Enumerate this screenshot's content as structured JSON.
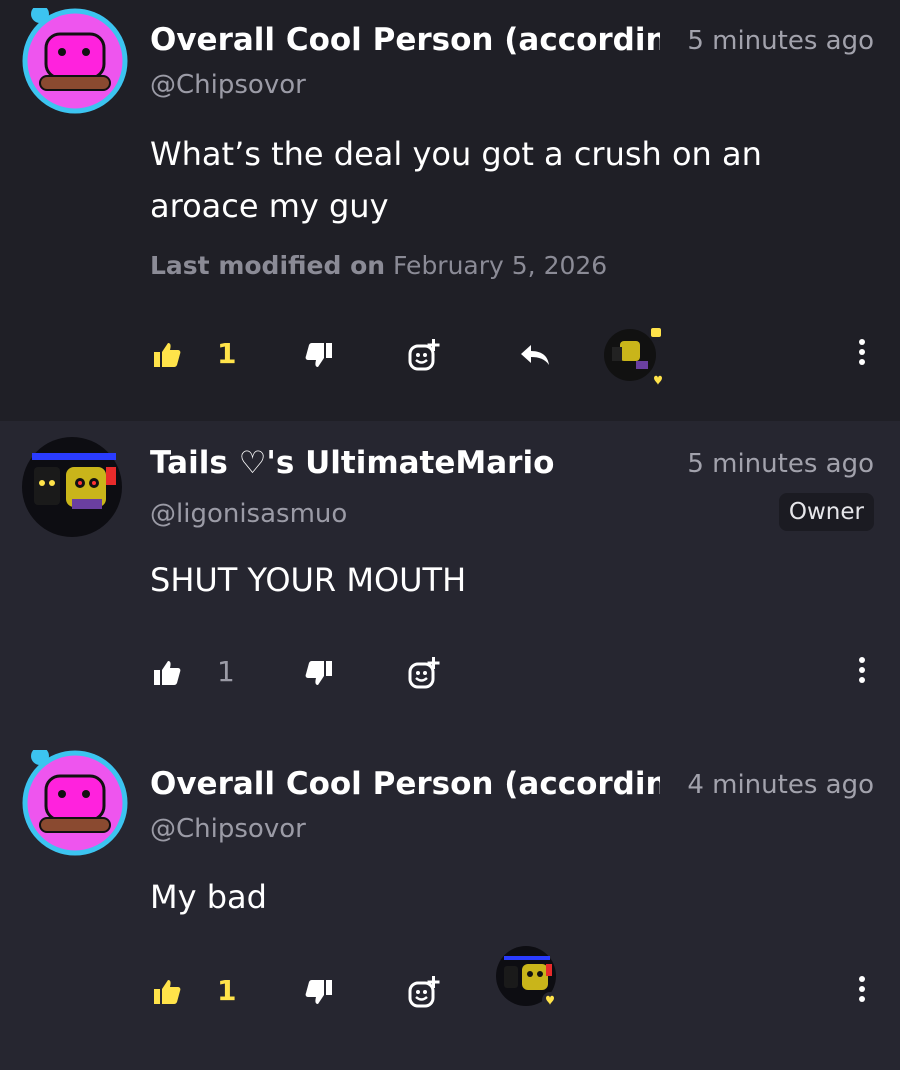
{
  "colors": {
    "accent_yellow": "#ffe34a",
    "bg_dark": "#1f1f26",
    "bg": "#262630",
    "muted": "#9b9ba6"
  },
  "comments": [
    {
      "name": "Overall Cool Person (according",
      "handle": "@Chipsovor",
      "time": "5 minutes ago",
      "text": "What’s the deal you got a crush on an aroace my guy",
      "modified_label": "Last modified on",
      "modified_date": "February 5, 2026",
      "likes": "1",
      "liked": true,
      "avatar_icon": "pink-character-avatar"
    },
    {
      "name": "Tails ♡'s UltimateMario",
      "handle": "@ligonisasmuo",
      "time": "5 minutes ago",
      "badge": "Owner",
      "text": "SHUT YOUR MOUTH",
      "likes": "1",
      "liked": false,
      "avatar_icon": "fnaf-character-avatar"
    },
    {
      "name": "Overall Cool Person (according",
      "handle": "@Chipsovor",
      "time": "4 minutes ago",
      "text": "My bad",
      "likes": "1",
      "liked": true,
      "avatar_icon": "pink-character-avatar"
    }
  ]
}
